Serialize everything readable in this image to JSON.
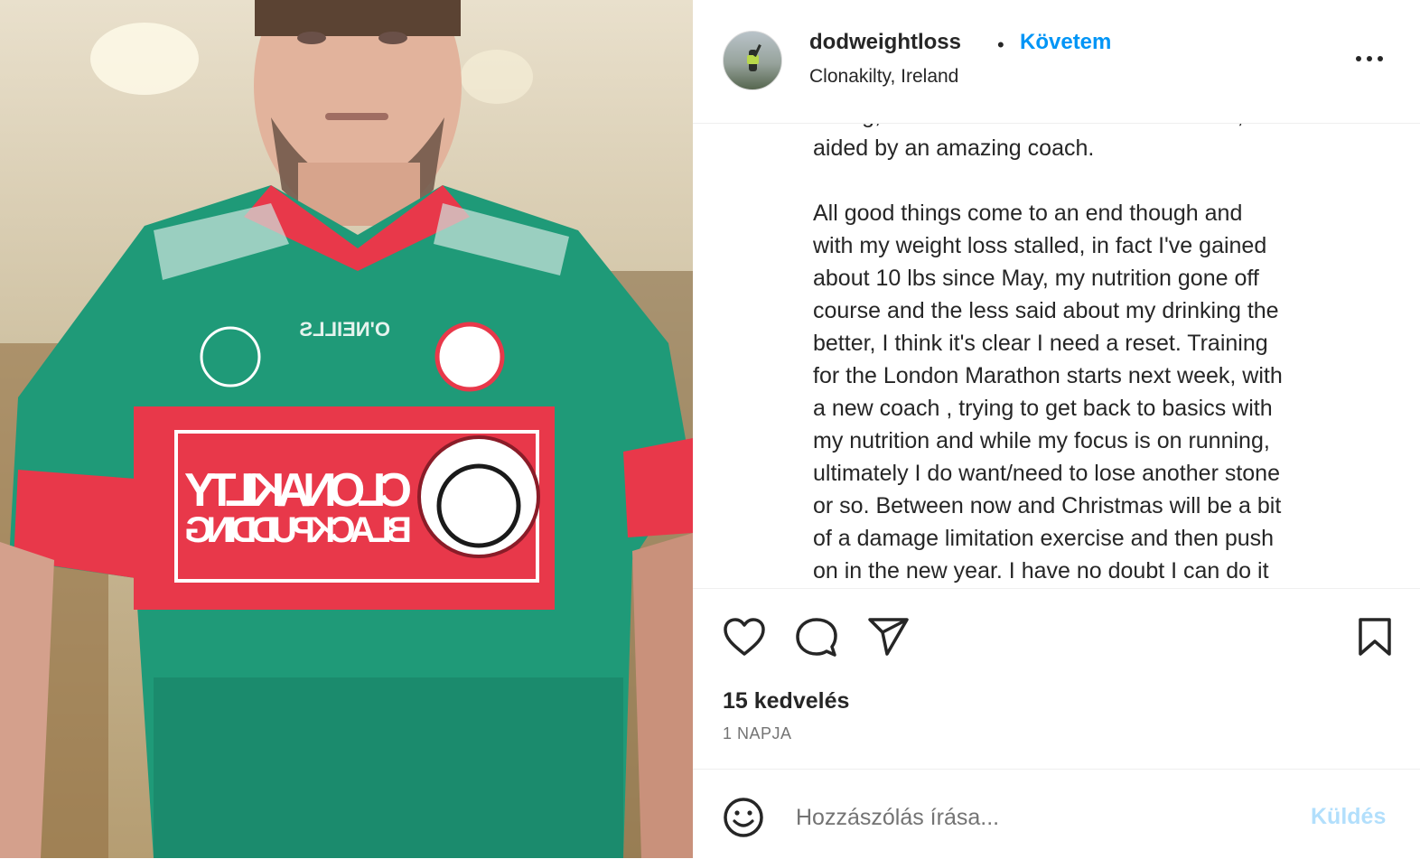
{
  "post": {
    "author": {
      "username": "dodweightloss",
      "separator": "•",
      "follow_label": "Követem",
      "location": "Clonakilty, Ireland"
    },
    "caption_lines": [
      "wrong, but all in all I think it was a success,",
      "aided by an amazing coach.",
      "",
      "All good things come to an end though and",
      "with my weight loss stalled, in fact I've gained",
      "about 10 lbs since May, my nutrition gone off",
      "course and the less said about my drinking the",
      "better, I think it's clear I need a reset. Training",
      "for the London Marathon starts next week, with",
      "a new coach , trying to get back to basics with",
      "my nutrition and while my focus is on running,",
      "ultimately I do want/need to lose another stone",
      "or so. Between now and Christmas will be a bit",
      "of a damage limitation exercise and then push",
      "on in the new year. I have no doubt I can do it"
    ],
    "likes_label": "15 kedvelés",
    "date_label": "1 NAPJA",
    "photo_jersey_text": {
      "maker": "O'NEILLS",
      "sponsor_line1": "CLONAKILTY",
      "sponsor_line2": "BLACKPUDDING"
    }
  },
  "composer": {
    "placeholder": "Hozzászólás írása...",
    "send_label": "Küldés"
  },
  "icons": [
    "heart-icon",
    "comment-icon",
    "share-icon",
    "bookmark-icon",
    "more-icon",
    "emoji-icon"
  ],
  "colors": {
    "accent": "#0095f6",
    "send_disabled": "#b2dffc",
    "text": "#262626",
    "muted": "#737373",
    "jersey_green": "#1f9a78",
    "jersey_red": "#e8384a"
  }
}
